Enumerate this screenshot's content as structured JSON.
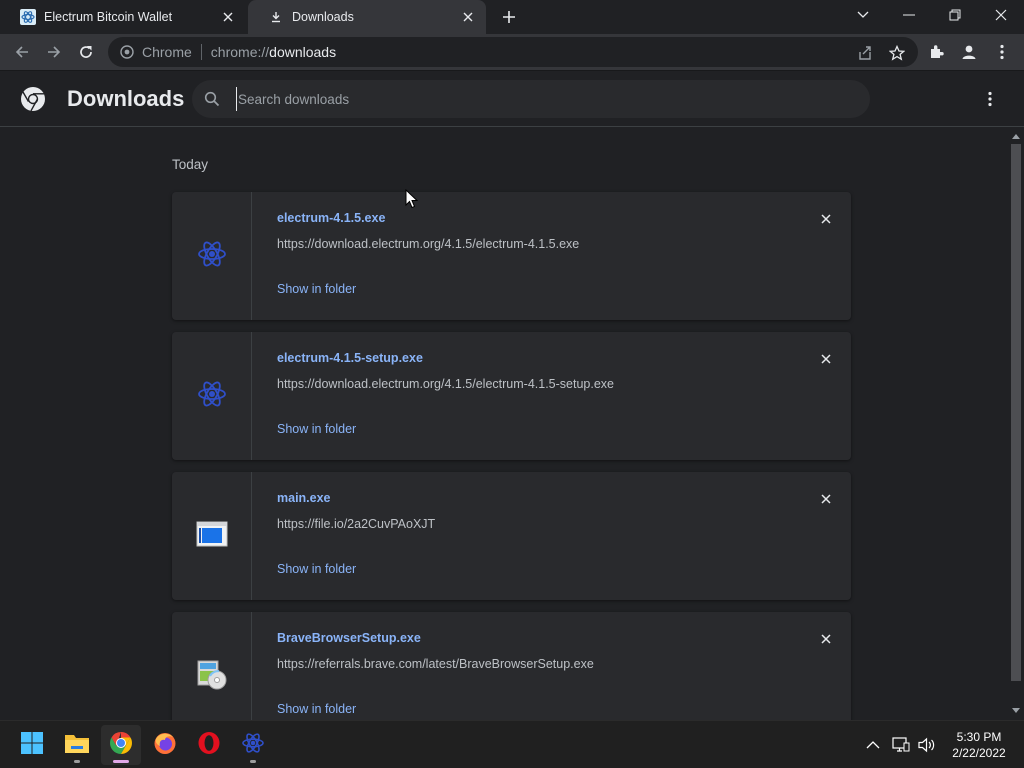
{
  "tabs": [
    {
      "title": "Electrum Bitcoin Wallet",
      "active": false,
      "icon": "electrum-icon"
    },
    {
      "title": "Downloads",
      "active": true,
      "icon": "download-icon"
    }
  ],
  "omnibox": {
    "chip": "Chrome",
    "url_scheme": "chrome://",
    "url_host": "downloads"
  },
  "header": {
    "title": "Downloads",
    "search_placeholder": "Search downloads"
  },
  "date_heading": "Today",
  "downloads": [
    {
      "filename": "electrum-4.1.5.exe",
      "url": "https://download.electrum.org/4.1.5/electrum-4.1.5.exe",
      "action": "Show in folder",
      "icon": "electrum-icon"
    },
    {
      "filename": "electrum-4.1.5-setup.exe",
      "url": "https://download.electrum.org/4.1.5/electrum-4.1.5-setup.exe",
      "action": "Show in folder",
      "icon": "electrum-icon"
    },
    {
      "filename": "main.exe",
      "url": "https://file.io/2a2CuvPAoXJT",
      "action": "Show in folder",
      "icon": "exe-window-icon"
    },
    {
      "filename": "BraveBrowserSetup.exe",
      "url": "https://referrals.brave.com/latest/BraveBrowserSetup.exe",
      "action": "Show in folder",
      "icon": "installer-icon"
    }
  ],
  "taskbar": {
    "apps": [
      "start-icon",
      "file-explorer-icon",
      "chrome-icon",
      "firefox-icon",
      "opera-icon",
      "electrum-icon"
    ],
    "time": "5:30 PM",
    "date": "2/22/2022"
  },
  "colors": {
    "link": "#8ab4f8",
    "background": "#202124",
    "card": "#292a2d",
    "toolbar": "#35363a"
  }
}
